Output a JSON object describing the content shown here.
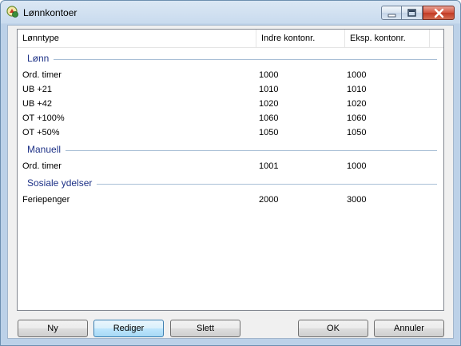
{
  "window": {
    "title": "Lønnkontoer"
  },
  "columns": [
    "Lønntype",
    "Indre kontonr.",
    "Eksp. kontonr."
  ],
  "groups": [
    {
      "title": "Lønn",
      "rows": [
        [
          "Ord. timer",
          "1000",
          "1000"
        ],
        [
          "UB +21",
          "1010",
          "1010"
        ],
        [
          "UB +42",
          "1020",
          "1020"
        ],
        [
          "OT +100%",
          "1060",
          "1060"
        ],
        [
          "OT +50%",
          "1050",
          "1050"
        ]
      ]
    },
    {
      "title": "Manuell",
      "rows": [
        [
          "Ord. timer",
          "1001",
          "1000"
        ]
      ]
    },
    {
      "title": "Sosiale ydelser",
      "rows": [
        [
          "Feriepenger",
          "2000",
          "3000"
        ]
      ]
    }
  ],
  "buttons": {
    "ny": "Ny",
    "rediger": "Rediger",
    "slett": "Slett",
    "ok": "OK",
    "annuler": "Annuler"
  },
  "colors": {
    "group_title": "#1e3287",
    "titlebar": "#c9dbee",
    "close": "#c23a25"
  }
}
